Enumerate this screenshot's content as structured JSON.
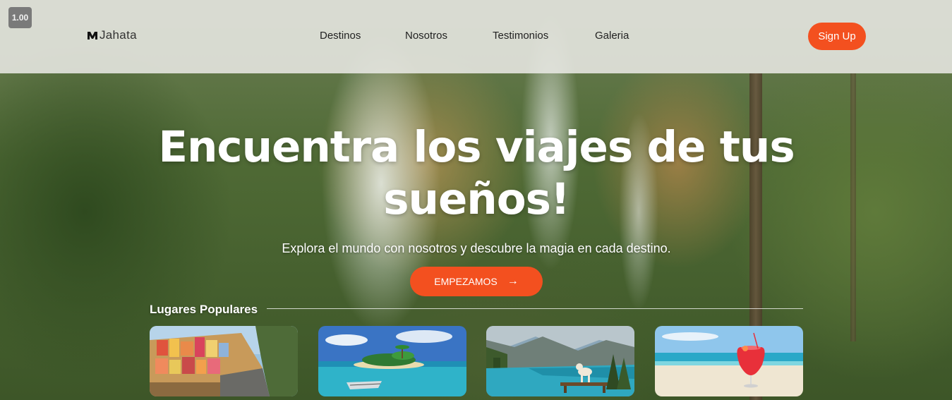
{
  "zoom_level": "1.00",
  "brand": {
    "name": "Jahata"
  },
  "nav": {
    "links": [
      "Destinos",
      "Nosotros",
      "Testimonios",
      "Galeria"
    ],
    "signup_label": "Sign Up"
  },
  "hero": {
    "title_line1": "Encuentra los viajes de tus",
    "title_line2": "sueños!",
    "subtitle": "Explora el mundo con nosotros y descubre la magia en cada destino.",
    "cta_label": "EMPEZAMOS",
    "cta_icon": "arrow-right-icon"
  },
  "popular": {
    "heading": "Lugares Populares",
    "cards": [
      {
        "scene": "coastal-village"
      },
      {
        "scene": "tropical-island"
      },
      {
        "scene": "mountain-lake"
      },
      {
        "scene": "beach-drink"
      }
    ]
  },
  "colors": {
    "accent": "#f3501f",
    "nav_bg": "#e8e8e4"
  }
}
